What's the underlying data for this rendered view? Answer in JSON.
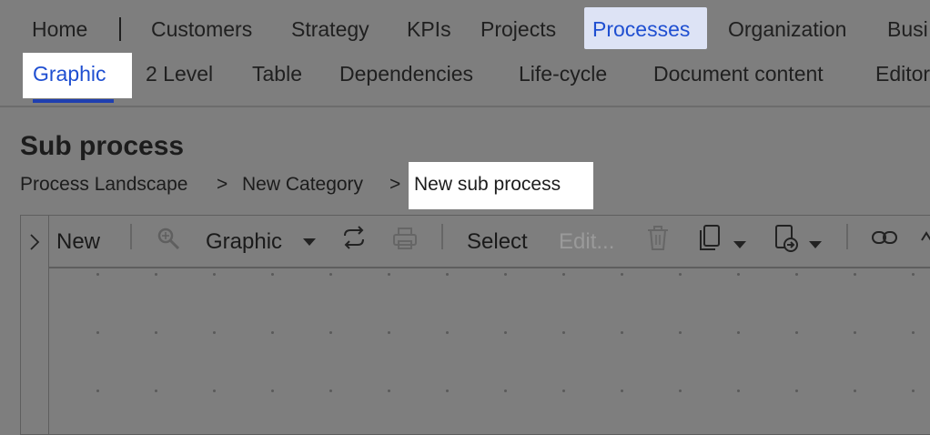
{
  "top_nav": {
    "items": [
      "Home",
      "Customers",
      "Strategy",
      "KPIs",
      "Projects",
      "Processes",
      "Organization",
      "Busi"
    ],
    "active": "Processes"
  },
  "sub_nav": {
    "items": [
      "Graphic",
      "2 Level",
      "Table",
      "Dependencies",
      "Life-cycle",
      "Document content",
      "Editor"
    ],
    "active": "Graphic"
  },
  "page": {
    "title": "Sub process"
  },
  "breadcrumb": {
    "items": [
      "Process Landscape",
      "New Category",
      "New sub process"
    ],
    "separator": ">"
  },
  "toolbar": {
    "new_label": "New",
    "graphic_label": "Graphic",
    "select_label": "Select",
    "edit_label": "Edit..."
  },
  "colors": {
    "active_text": "#1f4fd1",
    "active_tab_bg": "#dde3f5",
    "underline": "#1f3fb0"
  }
}
